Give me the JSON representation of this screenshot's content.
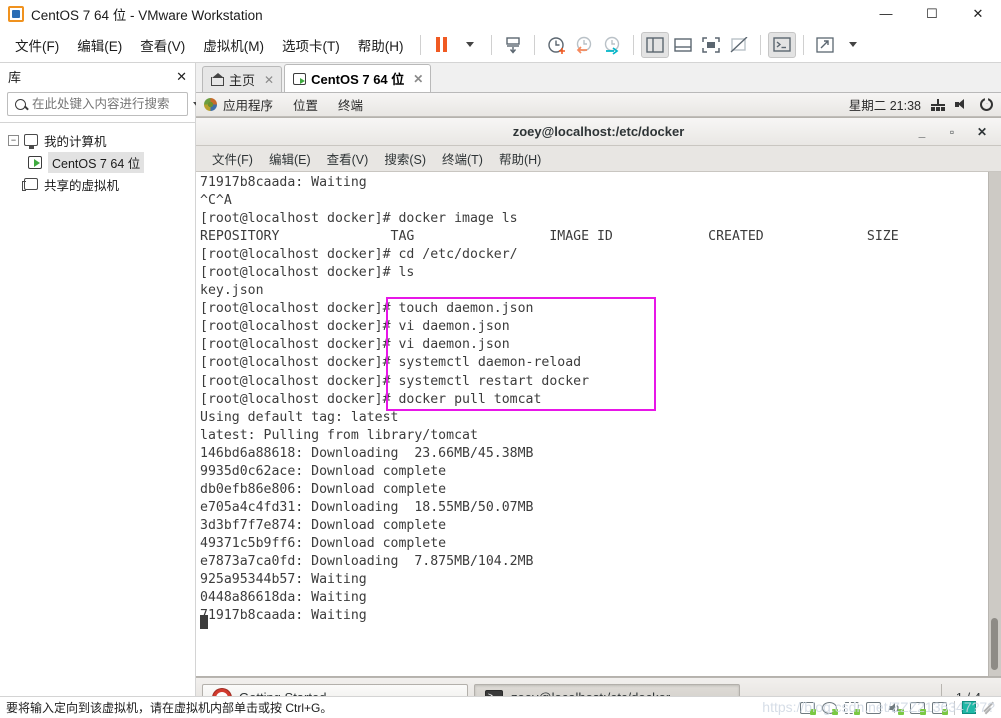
{
  "window": {
    "title": "CentOS 7 64 位 - VMware Workstation",
    "minimize": "—",
    "maximize": "☐",
    "close": "✕"
  },
  "menubar": {
    "items": [
      "文件(F)",
      "编辑(E)",
      "查看(V)",
      "虚拟机(M)",
      "选项卡(T)",
      "帮助(H)"
    ]
  },
  "toolbar": {
    "icons": [
      "pause-icon",
      "dropdown-caret-icon",
      "snapshot-take-icon",
      "snapshot-manager-icon",
      "snapshot-revert-icon",
      "snapshot-settings-icon",
      "show-library-icon",
      "show-thumbnail-bar-icon",
      "fullscreen-icon",
      "unity-mode-icon",
      "console-icon",
      "stretch-icon",
      "stretch-caret-icon"
    ]
  },
  "library": {
    "title": "库",
    "close_label": "✕",
    "search_placeholder": "在此处键入内容进行搜索",
    "search_value": "",
    "tree": [
      {
        "label": "我的计算机",
        "icon": "monitor-icon",
        "expander": "−",
        "level": 0
      },
      {
        "label": "CentOS 7 64 位",
        "icon": "vm-running-icon",
        "level": 1,
        "selected": true
      },
      {
        "label": "共享的虚拟机",
        "icon": "shared-vm-icon",
        "level": 0
      }
    ]
  },
  "tabs": [
    {
      "label": "主页",
      "icon": "home-icon",
      "close": "✕",
      "active": false
    },
    {
      "label": "CentOS 7 64 位",
      "icon": "vm-running-icon",
      "close": "✕",
      "active": true
    }
  ],
  "guest": {
    "panel": {
      "applications": "应用程序",
      "places": "位置",
      "terminal": "终端",
      "clock": "星期二  21:38",
      "tray": [
        "network-icon",
        "volume-icon",
        "power-icon"
      ]
    },
    "terminal_window": {
      "title": "zoey@localhost:/etc/docker",
      "controls": {
        "minimize": "_",
        "maximize": "▫",
        "close": "✕"
      },
      "menu": [
        "文件(F)",
        "编辑(E)",
        "查看(V)",
        "搜索(S)",
        "终端(T)",
        "帮助(H)"
      ],
      "lines": [
        "71917b8caada: Waiting",
        "^C^A",
        "[root@localhost docker]# docker image ls",
        "REPOSITORY              TAG                 IMAGE ID            CREATED             SIZE",
        "[root@localhost docker]# cd /etc/docker/",
        "[root@localhost docker]# ls",
        "key.json",
        "[root@localhost docker]# touch daemon.json",
        "[root@localhost docker]# vi daemon.json",
        "[root@localhost docker]# vi daemon.json",
        "[root@localhost docker]# systemctl daemon-reload",
        "[root@localhost docker]# systemctl restart docker",
        "[root@localhost docker]# docker pull tomcat",
        "Using default tag: latest",
        "latest: Pulling from library/tomcat",
        "146bd6a88618: Downloading  23.66MB/45.38MB",
        "9935d0c62ace: Download complete",
        "db0efb86e806: Download complete",
        "e705a4c4fd31: Downloading  18.55MB/50.07MB",
        "3d3bf7f7e874: Download complete",
        "49371c5b9ff6: Download complete",
        "e7873a7ca0fd: Downloading  7.875MB/104.2MB",
        "925a95344b57: Waiting",
        "0448a86618da: Waiting",
        "71917b8caada: Waiting"
      ],
      "highlight_color": "#e716e7",
      "highlighted_commands": [
        "touch daemon.json",
        "vi daemon.json",
        "vi daemon.json",
        "systemctl daemon-reload",
        "systemctl restart docker",
        "docker pull tomcat"
      ]
    },
    "taskbar": {
      "buttons": [
        {
          "label": "Getting Started",
          "icon": "lifebuoy-icon",
          "active": false
        },
        {
          "label": "zoey@localhost:/etc/docker",
          "icon": "terminal-icon",
          "active": true
        }
      ],
      "workspace": "1 / 4"
    },
    "watermark": "https://blog.csdn.net/ZZZ2136347?7?"
  },
  "statusbar": {
    "message": "要将输入定向到该虚拟机，请在虚拟机内部单击或按 Ctrl+G。",
    "devices": [
      "hard-disk-icon",
      "cd-dvd-icon",
      "network-adapter-icon",
      "printer-icon",
      "sound-card-icon",
      "usb-device-icon",
      "usb-device-icon"
    ],
    "extra": [
      "teal-indicator-icon",
      "resize-grip-icon"
    ]
  }
}
